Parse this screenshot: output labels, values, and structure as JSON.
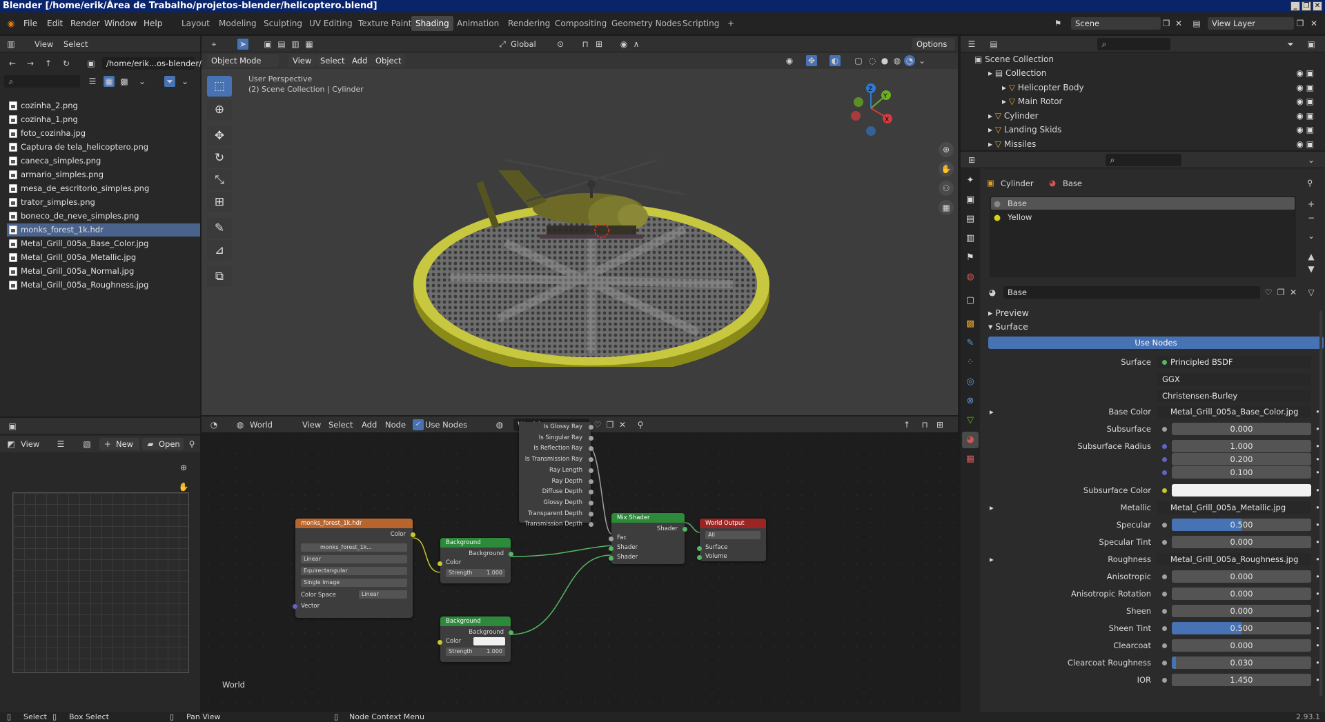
{
  "window": {
    "title": "Blender [/home/erik/Área de Trabalho/projetos-blender/helicoptero.blend]",
    "controls": [
      "_",
      "❐",
      "✕"
    ]
  },
  "top_menu": [
    "File",
    "Edit",
    "Render",
    "Window",
    "Help"
  ],
  "workspaces": [
    "Layout",
    "Modeling",
    "Sculpting",
    "UV Editing",
    "Texture Paint",
    "Shading",
    "Animation",
    "Rendering",
    "Compositing",
    "Geometry Nodes",
    "Scripting",
    "+"
  ],
  "scene": {
    "scene_name": "Scene",
    "view_layer": "View Layer"
  },
  "file_browser": {
    "menus": [
      "View",
      "Select"
    ],
    "path": "/home/erik...os-blender/",
    "search_placeholder": "",
    "files": [
      "cozinha_2.png",
      "cozinha_1.png",
      "foto_cozinha.jpg",
      "Captura de tela_helicoptero.png",
      "caneca_simples.png",
      "armario_simples.png",
      "mesa_de_escritorio_simples.png",
      "trator_simples.png",
      "boneco_de_neve_simples.png",
      "monks_forest_1k.hdr",
      "Metal_Grill_005a_Base_Color.jpg",
      "Metal_Grill_005a_Metallic.jpg",
      "Metal_Grill_005a_Normal.jpg",
      "Metal_Grill_005a_Roughness.jpg"
    ],
    "selected_index": 9
  },
  "viewport": {
    "mode": "Object Mode",
    "menus": [
      "View",
      "Select",
      "Add",
      "Object"
    ],
    "transform": "Global",
    "options": "Options",
    "overlay_line1": "User Perspective",
    "overlay_line2": "(2) Scene Collection | Cylinder",
    "gizmo_axes": [
      "Z",
      "Y",
      "X"
    ]
  },
  "image_editor": {
    "view": "View",
    "new": "New",
    "open": "Open"
  },
  "node_editor": {
    "type": "World",
    "menus": [
      "View",
      "Select",
      "Add",
      "Node"
    ],
    "use_nodes": "Use Nodes",
    "world_name": "World",
    "footer_label": "World",
    "light_path_outputs": [
      "Is Glossy Ray",
      "Is Singular Ray",
      "Is Reflection Ray",
      "Is Transmission Ray",
      "Ray Length",
      "Ray Depth",
      "Diffuse Depth",
      "Glossy Depth",
      "Transparent Depth",
      "Transmission Depth"
    ],
    "env_node": {
      "title": "monks_forest_1k.hdr",
      "output": "Color",
      "image": "monks_forest_1k...",
      "interp": "Linear",
      "proj": "Equirectangular",
      "source": "Single Image",
      "cs_label": "Color Space",
      "cs_value": "Linear",
      "input": "Vector"
    },
    "bg1": {
      "title": "Background",
      "output": "Background",
      "in_color": "Color",
      "strength": "Strength",
      "strength_val": "1.000"
    },
    "bg2": {
      "title": "Background",
      "output": "Background",
      "in_color": "Color",
      "strength": "Strength",
      "strength_val": "1.000"
    },
    "mix": {
      "title": "Mix Shader",
      "output": "Shader",
      "in_fac": "Fac",
      "in_shader1": "Shader",
      "in_shader2": "Shader"
    },
    "out": {
      "title": "World Output",
      "target": "All",
      "in_surface": "Surface",
      "in_volume": "Volume"
    }
  },
  "outliner": {
    "root": "Scene Collection",
    "items": [
      {
        "label": "Collection",
        "level": 1
      },
      {
        "label": "Helicopter Body",
        "level": 2
      },
      {
        "label": "Main Rotor",
        "level": 2
      },
      {
        "label": "Cylinder",
        "level": 1
      },
      {
        "label": "Landing Skids",
        "level": 1
      },
      {
        "label": "Missiles",
        "level": 1
      }
    ]
  },
  "properties": {
    "breadcrumb_object": "Cylinder",
    "breadcrumb_material": "Base",
    "slots": [
      "Base",
      "Yellow"
    ],
    "material_name": "Base",
    "panels": {
      "preview": "Preview",
      "surface": "Surface"
    },
    "use_nodes": "Use Nodes",
    "surface_label": "Surface",
    "surface_value": "Principled BSDF",
    "distribution": "GGX",
    "subsurface_method": "Christensen-Burley",
    "rows": [
      {
        "label": "Base Color",
        "value": "Metal_Grill_005a_Base_Color.jpg",
        "kind": "link"
      },
      {
        "label": "Subsurface",
        "value": "0.000",
        "kind": "num",
        "fill": 0
      },
      {
        "label": "Subsurface Radius",
        "value": "1.000",
        "kind": "num",
        "fill": 0
      },
      {
        "label": "",
        "value": "0.200",
        "kind": "num",
        "fill": 0
      },
      {
        "label": "",
        "value": "0.100",
        "kind": "num",
        "fill": 0
      },
      {
        "label": "Subsurface Color",
        "value": "",
        "kind": "color"
      },
      {
        "label": "Metallic",
        "value": "Metal_Grill_005a_Metallic.jpg",
        "kind": "link"
      },
      {
        "label": "Specular",
        "value": "0.500",
        "kind": "num",
        "fill": 0.5
      },
      {
        "label": "Specular Tint",
        "value": "0.000",
        "kind": "num",
        "fill": 0
      },
      {
        "label": "Roughness",
        "value": "Metal_Grill_005a_Roughness.jpg",
        "kind": "link"
      },
      {
        "label": "Anisotropic",
        "value": "0.000",
        "kind": "num",
        "fill": 0
      },
      {
        "label": "Anisotropic Rotation",
        "value": "0.000",
        "kind": "num",
        "fill": 0
      },
      {
        "label": "Sheen",
        "value": "0.000",
        "kind": "num",
        "fill": 0
      },
      {
        "label": "Sheen Tint",
        "value": "0.500",
        "kind": "num",
        "fill": 0.5
      },
      {
        "label": "Clearcoat",
        "value": "0.000",
        "kind": "num",
        "fill": 0
      },
      {
        "label": "Clearcoat Roughness",
        "value": "0.030",
        "kind": "num",
        "fill": 0.03
      },
      {
        "label": "IOR",
        "value": "1.450",
        "kind": "num",
        "fill": 0
      }
    ]
  },
  "status_bar": {
    "select": "Select",
    "box_select": "Box Select",
    "pan_view": "Pan View",
    "context_menu": "Node Context Menu",
    "version": "2.93.1"
  },
  "colors": {
    "accent": "#4772b3",
    "selected_row": "#4a638c",
    "shader_header": "#2c8a3a",
    "output_header": "#9b2525",
    "texture_header": "#b8642d"
  }
}
